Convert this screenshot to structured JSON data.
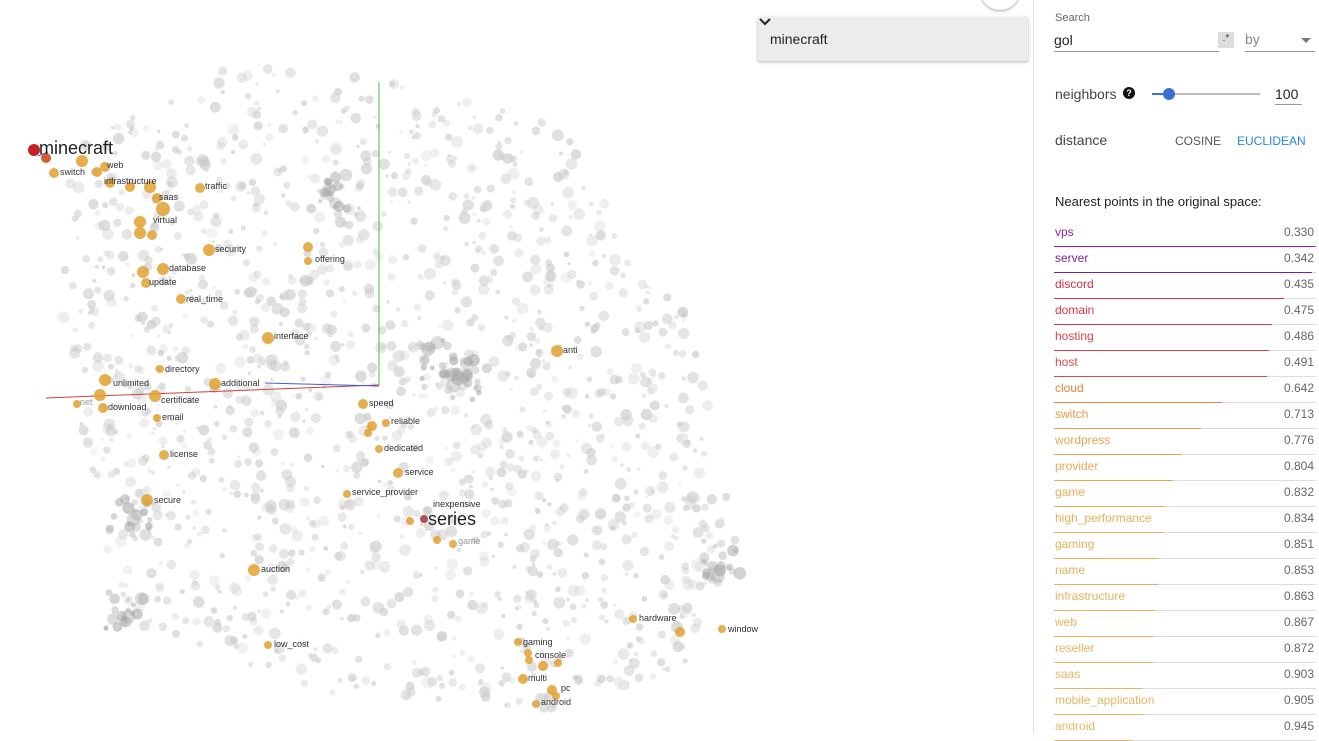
{
  "viz": {
    "colors": {
      "cloud": "#cccccc",
      "highlight": "#e0a030",
      "selected": "#c0151b",
      "axis_x": "#d04040",
      "axis_y": "#40c040",
      "axis_z": "#4060d0"
    },
    "big_labels": {
      "selected_word": "minecraft",
      "series_word": "series"
    },
    "labels": [
      "web",
      "switch",
      "infrastructure",
      "traffic",
      "saas",
      "virtual",
      "security",
      "offering",
      "database",
      "update",
      "real_time",
      "interface",
      "anti",
      "directory",
      "unlimited",
      "additional",
      "net",
      "download",
      "certificate",
      "email",
      "speed",
      "reliable",
      "dedicated",
      "license",
      "service",
      "service_provider",
      "inexpensive",
      "game",
      "secure",
      "auction",
      "hardware",
      "window",
      "low_cost",
      "gaming",
      "console",
      "multi",
      "pc",
      "android"
    ]
  },
  "dropdown": {
    "value": "minecraft",
    "icon": "chevron-down-icon"
  },
  "panel": {
    "search_label": "Search",
    "search_value": "gol",
    "regex_label": ".*",
    "by_label": "by",
    "neighbors_label": "neighbors",
    "help_icon": "?",
    "neighbors_value": "100",
    "neighbors_fraction": 0.1,
    "distance_label": "distance",
    "cosine_label": "COSINE",
    "euclidean_label": "EUCLIDEAN",
    "nearest_title": "Nearest points in the original space:",
    "nearest": [
      {
        "name": "vps",
        "value": "0.330",
        "color": "#8e24aa"
      },
      {
        "name": "server",
        "value": "0.342",
        "color": "#7b1fa2"
      },
      {
        "name": "discord",
        "value": "0.435",
        "color": "#d6304a"
      },
      {
        "name": "domain",
        "value": "0.475",
        "color": "#dc3545"
      },
      {
        "name": "hosting",
        "value": "0.486",
        "color": "#e04050"
      },
      {
        "name": "host",
        "value": "0.491",
        "color": "#e04848"
      },
      {
        "name": "cloud",
        "value": "0.642",
        "color": "#e8823a"
      },
      {
        "name": "switch",
        "value": "0.713",
        "color": "#eb9a45"
      },
      {
        "name": "wordpress",
        "value": "0.776",
        "color": "#e8a64e"
      },
      {
        "name": "provider",
        "value": "0.804",
        "color": "#e8aa55"
      },
      {
        "name": "game",
        "value": "0.832",
        "color": "#e8ae58"
      },
      {
        "name": "high_performance",
        "value": "0.834",
        "color": "#e8ae58"
      },
      {
        "name": "gaming",
        "value": "0.851",
        "color": "#e8b05a"
      },
      {
        "name": "name",
        "value": "0.853",
        "color": "#e8b05a"
      },
      {
        "name": "infrastructure",
        "value": "0.863",
        "color": "#e8b25c"
      },
      {
        "name": "web",
        "value": "0.867",
        "color": "#e8b25c"
      },
      {
        "name": "reseller",
        "value": "0.872",
        "color": "#e8b45e"
      },
      {
        "name": "saas",
        "value": "0.903",
        "color": "#e8b662"
      },
      {
        "name": "mobile_application",
        "value": "0.905",
        "color": "#e8b662"
      },
      {
        "name": "android",
        "value": "0.945",
        "color": "#e8b866"
      }
    ]
  }
}
